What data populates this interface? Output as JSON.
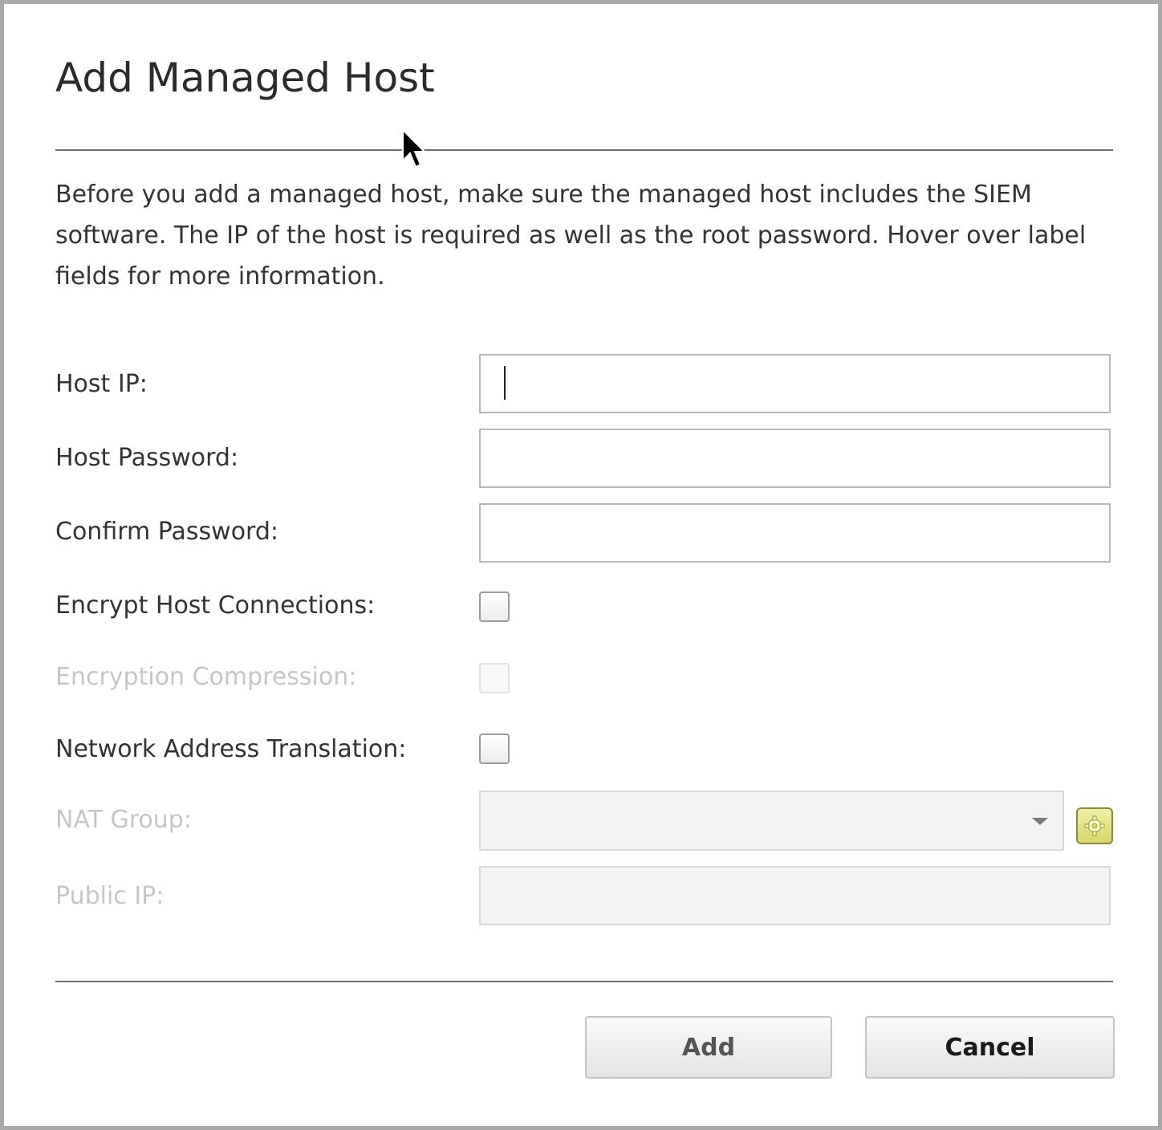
{
  "dialog": {
    "title": "Add Managed Host",
    "description": "Before you add a managed host, make sure the managed host includes the SIEM software. The IP of the host is required as well as the root password. Hover over label fields for more information."
  },
  "form": {
    "host_ip": {
      "label": "Host IP:",
      "value": ""
    },
    "host_password": {
      "label": "Host Password:",
      "value": ""
    },
    "confirm_password": {
      "label": "Confirm Password:",
      "value": ""
    },
    "encrypt_host_connections": {
      "label": "Encrypt Host Connections:",
      "checked": false
    },
    "encryption_compression": {
      "label": "Encryption Compression:",
      "checked": false,
      "disabled": true
    },
    "network_address_translation": {
      "label": "Network Address Translation:",
      "checked": false
    },
    "nat_group": {
      "label": "NAT Group:",
      "selected": "",
      "disabled": true,
      "settings_icon": "gear-icon"
    },
    "public_ip": {
      "label": "Public IP:",
      "value": "",
      "disabled": true
    }
  },
  "buttons": {
    "add_label": "Add",
    "cancel_label": "Cancel"
  },
  "colors": {
    "border": "#a9a9a9",
    "text": "#333333",
    "disabled_text": "#c6c6c6",
    "gear_accent": "#d6d66a"
  }
}
